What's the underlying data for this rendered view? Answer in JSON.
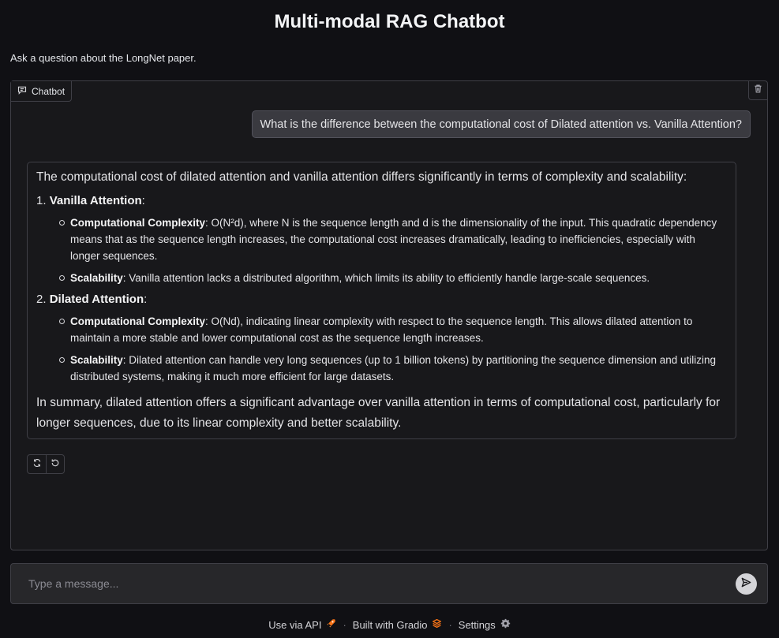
{
  "header": {
    "title": "Multi-modal RAG Chatbot",
    "subtitle": "Ask a question about the LongNet paper."
  },
  "chatbot": {
    "label": "Chatbot",
    "user_message": "What is the difference between the computational cost of Dilated attention vs. Vanilla Attention?",
    "bot": {
      "lead": "The computational cost of dilated attention and vanilla attention differs significantly in terms of complexity and scalability:",
      "items": [
        {
          "number": "1.",
          "title": "Vanilla Attention",
          "colon": ":",
          "points": [
            {
              "label": "Computational Complexity",
              "text": ": O(N²d), where N is the sequence length and d is the dimensionality of the input. This quadratic dependency means that as the sequence length increases, the computational cost increases dramatically, leading to inefficiencies, especially with longer sequences."
            },
            {
              "label": "Scalability",
              "text": ": Vanilla attention lacks a distributed algorithm, which limits its ability to efficiently handle large-scale sequences."
            }
          ]
        },
        {
          "number": "2.",
          "title": "Dilated Attention",
          "colon": ":",
          "points": [
            {
              "label": "Computational Complexity",
              "text": ": O(Nd), indicating linear complexity with respect to the sequence length. This allows dilated attention to maintain a more stable and lower computational cost as the sequence length increases."
            },
            {
              "label": "Scalability",
              "text": ": Dilated attention can handle very long sequences (up to 1 billion tokens) by partitioning the sequence dimension and utilizing distributed systems, making it much more efficient for large datasets."
            }
          ]
        }
      ],
      "summary": "In summary, dilated attention offers a significant advantage over vanilla attention in terms of computational cost, particularly for longer sequences, due to its linear complexity and better scalability."
    },
    "actions": [
      "retry-icon",
      "undo-icon"
    ]
  },
  "input": {
    "placeholder": "Type a message...",
    "value": ""
  },
  "footer": {
    "api": "Use via API",
    "built": "Built with Gradio",
    "settings": "Settings",
    "sep": "·"
  },
  "colors": {
    "background": "#101014",
    "panel": "#18181b",
    "border": "#3f3f46",
    "user_bubble": "#3a3a40",
    "gradio_orange": "#f97316"
  }
}
